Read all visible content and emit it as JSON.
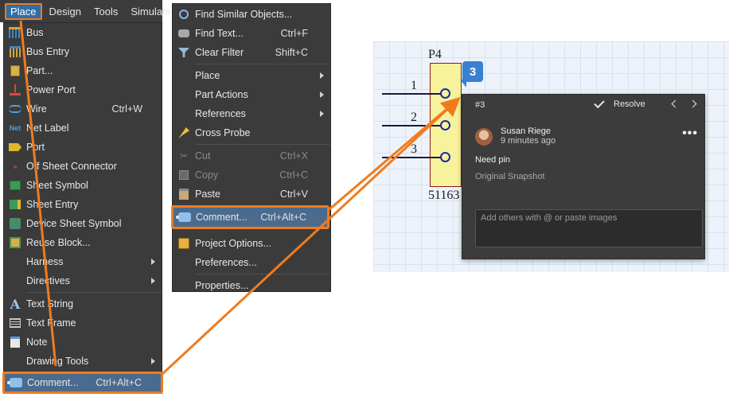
{
  "menubar": {
    "items": [
      "Place",
      "Design",
      "Tools",
      "Simulate"
    ]
  },
  "place_menu": {
    "items": [
      {
        "label": "Bus",
        "icon": "bus-icon"
      },
      {
        "label": "Bus Entry",
        "icon": "bus-entry-icon"
      },
      {
        "label": "Part...",
        "icon": "part-icon"
      },
      {
        "label": "Power Port",
        "icon": "power-port-icon"
      },
      {
        "label": "Wire",
        "icon": "wire-icon",
        "shortcut": "Ctrl+W"
      },
      {
        "label": "Net Label",
        "icon": "net-label-icon"
      },
      {
        "label": "Port",
        "icon": "port-icon"
      },
      {
        "label": "Off Sheet Connector",
        "icon": "off-sheet-connector-icon"
      },
      {
        "label": "Sheet Symbol",
        "icon": "sheet-symbol-icon"
      },
      {
        "label": "Sheet Entry",
        "icon": "sheet-entry-icon"
      },
      {
        "label": "Device Sheet Symbol",
        "icon": "device-sheet-symbol-icon"
      },
      {
        "label": "Reuse Block...",
        "icon": "reuse-block-icon"
      },
      {
        "label": "Harness",
        "submenu": true
      },
      {
        "label": "Directives",
        "submenu": true
      },
      {
        "label": "Text String",
        "icon": "text-string-icon"
      },
      {
        "label": "Text Frame",
        "icon": "text-frame-icon"
      },
      {
        "label": "Note",
        "icon": "note-icon"
      },
      {
        "label": "Drawing Tools",
        "submenu": true
      },
      {
        "label": "Comment...",
        "icon": "comment-icon",
        "shortcut": "Ctrl+Alt+C",
        "highlighted": true
      }
    ]
  },
  "context_menu": {
    "items": [
      {
        "label": "Find Similar Objects...",
        "icon": "magnifier-icon"
      },
      {
        "label": "Find Text...",
        "icon": "binoculars-icon",
        "shortcut": "Ctrl+F"
      },
      {
        "label": "Clear Filter",
        "icon": "clear-filter-icon",
        "shortcut": "Shift+C"
      },
      {
        "label": "Place",
        "submenu": true
      },
      {
        "label": "Part Actions",
        "submenu": true
      },
      {
        "label": "References",
        "submenu": true
      },
      {
        "label": "Cross Probe",
        "icon": "cross-probe-icon"
      },
      {
        "label": "Cut",
        "icon": "scissors-icon",
        "shortcut": "Ctrl+X",
        "disabled": true
      },
      {
        "label": "Copy",
        "icon": "copy-icon",
        "shortcut": "Ctrl+C",
        "disabled": true
      },
      {
        "label": "Paste",
        "icon": "paste-icon",
        "shortcut": "Ctrl+V"
      },
      {
        "label": "Comment...",
        "icon": "comment-icon",
        "shortcut": "Ctrl+Alt+C",
        "highlighted": true
      },
      {
        "label": "Project Options...",
        "icon": "project-options-icon"
      },
      {
        "label": "Preferences..."
      },
      {
        "label": "Properties..."
      }
    ]
  },
  "schematic": {
    "designator": "P4",
    "part_number": "51163",
    "pins": [
      "1",
      "2",
      "3"
    ],
    "comment_marker": "3"
  },
  "comment_panel": {
    "id": "#3",
    "resolve_label": "Resolve",
    "user_name": "Susan Riege",
    "timestamp": "9 minutes ago",
    "message": "Need pin",
    "snapshot_label": "Original Snapshot",
    "reply_placeholder": "Add others with @ or paste images"
  },
  "colors": {
    "highlight_border": "#f07b1d",
    "menu_background": "#3b3b3b",
    "selected_item": "#4a6b8e",
    "marker_blue": "#3a7fd0",
    "component_fill": "#f7f29c"
  }
}
